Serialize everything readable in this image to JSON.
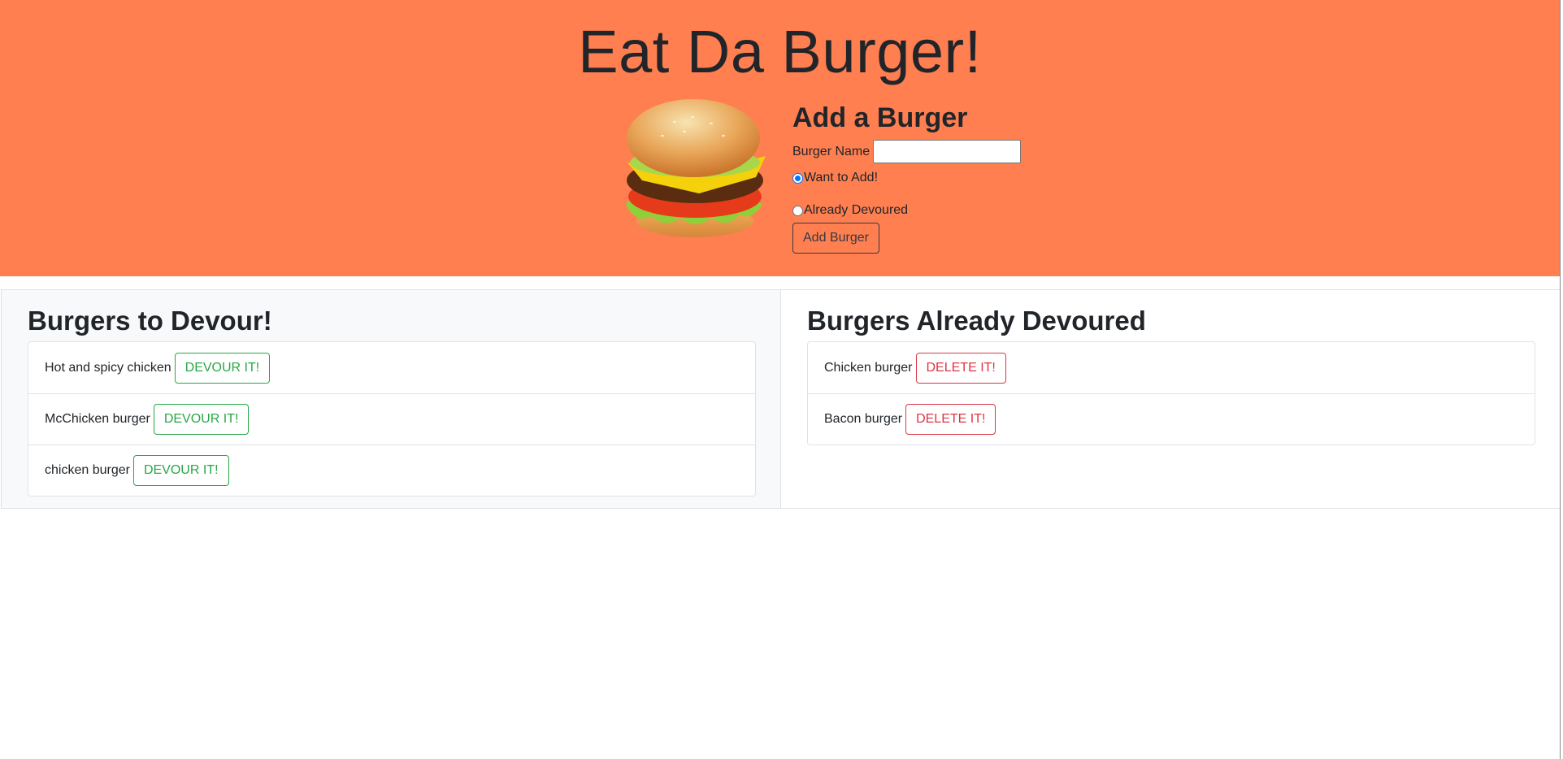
{
  "header": {
    "title": "Eat Da Burger!",
    "background_color": "#ff7f50",
    "image_icon": "burger-illustration"
  },
  "add_form": {
    "heading": "Add a Burger",
    "name_label": "Burger Name",
    "name_value": "",
    "radio_options": [
      {
        "label": "Want to Add!",
        "checked": true
      },
      {
        "label": "Already Devoured",
        "checked": false
      }
    ],
    "submit_label": "Add Burger"
  },
  "to_devour": {
    "heading": "Burgers to Devour!",
    "button_label": "DEVOUR IT!",
    "button_color": "#28a745",
    "items": [
      {
        "name": "Hot and spicy chicken"
      },
      {
        "name": "McChicken burger"
      },
      {
        "name": "chicken burger"
      }
    ]
  },
  "devoured": {
    "heading": "Burgers Already Devoured",
    "button_label": "DELETE IT!",
    "button_color": "#dc3545",
    "items": [
      {
        "name": "Chicken burger"
      },
      {
        "name": "Bacon burger"
      }
    ]
  }
}
